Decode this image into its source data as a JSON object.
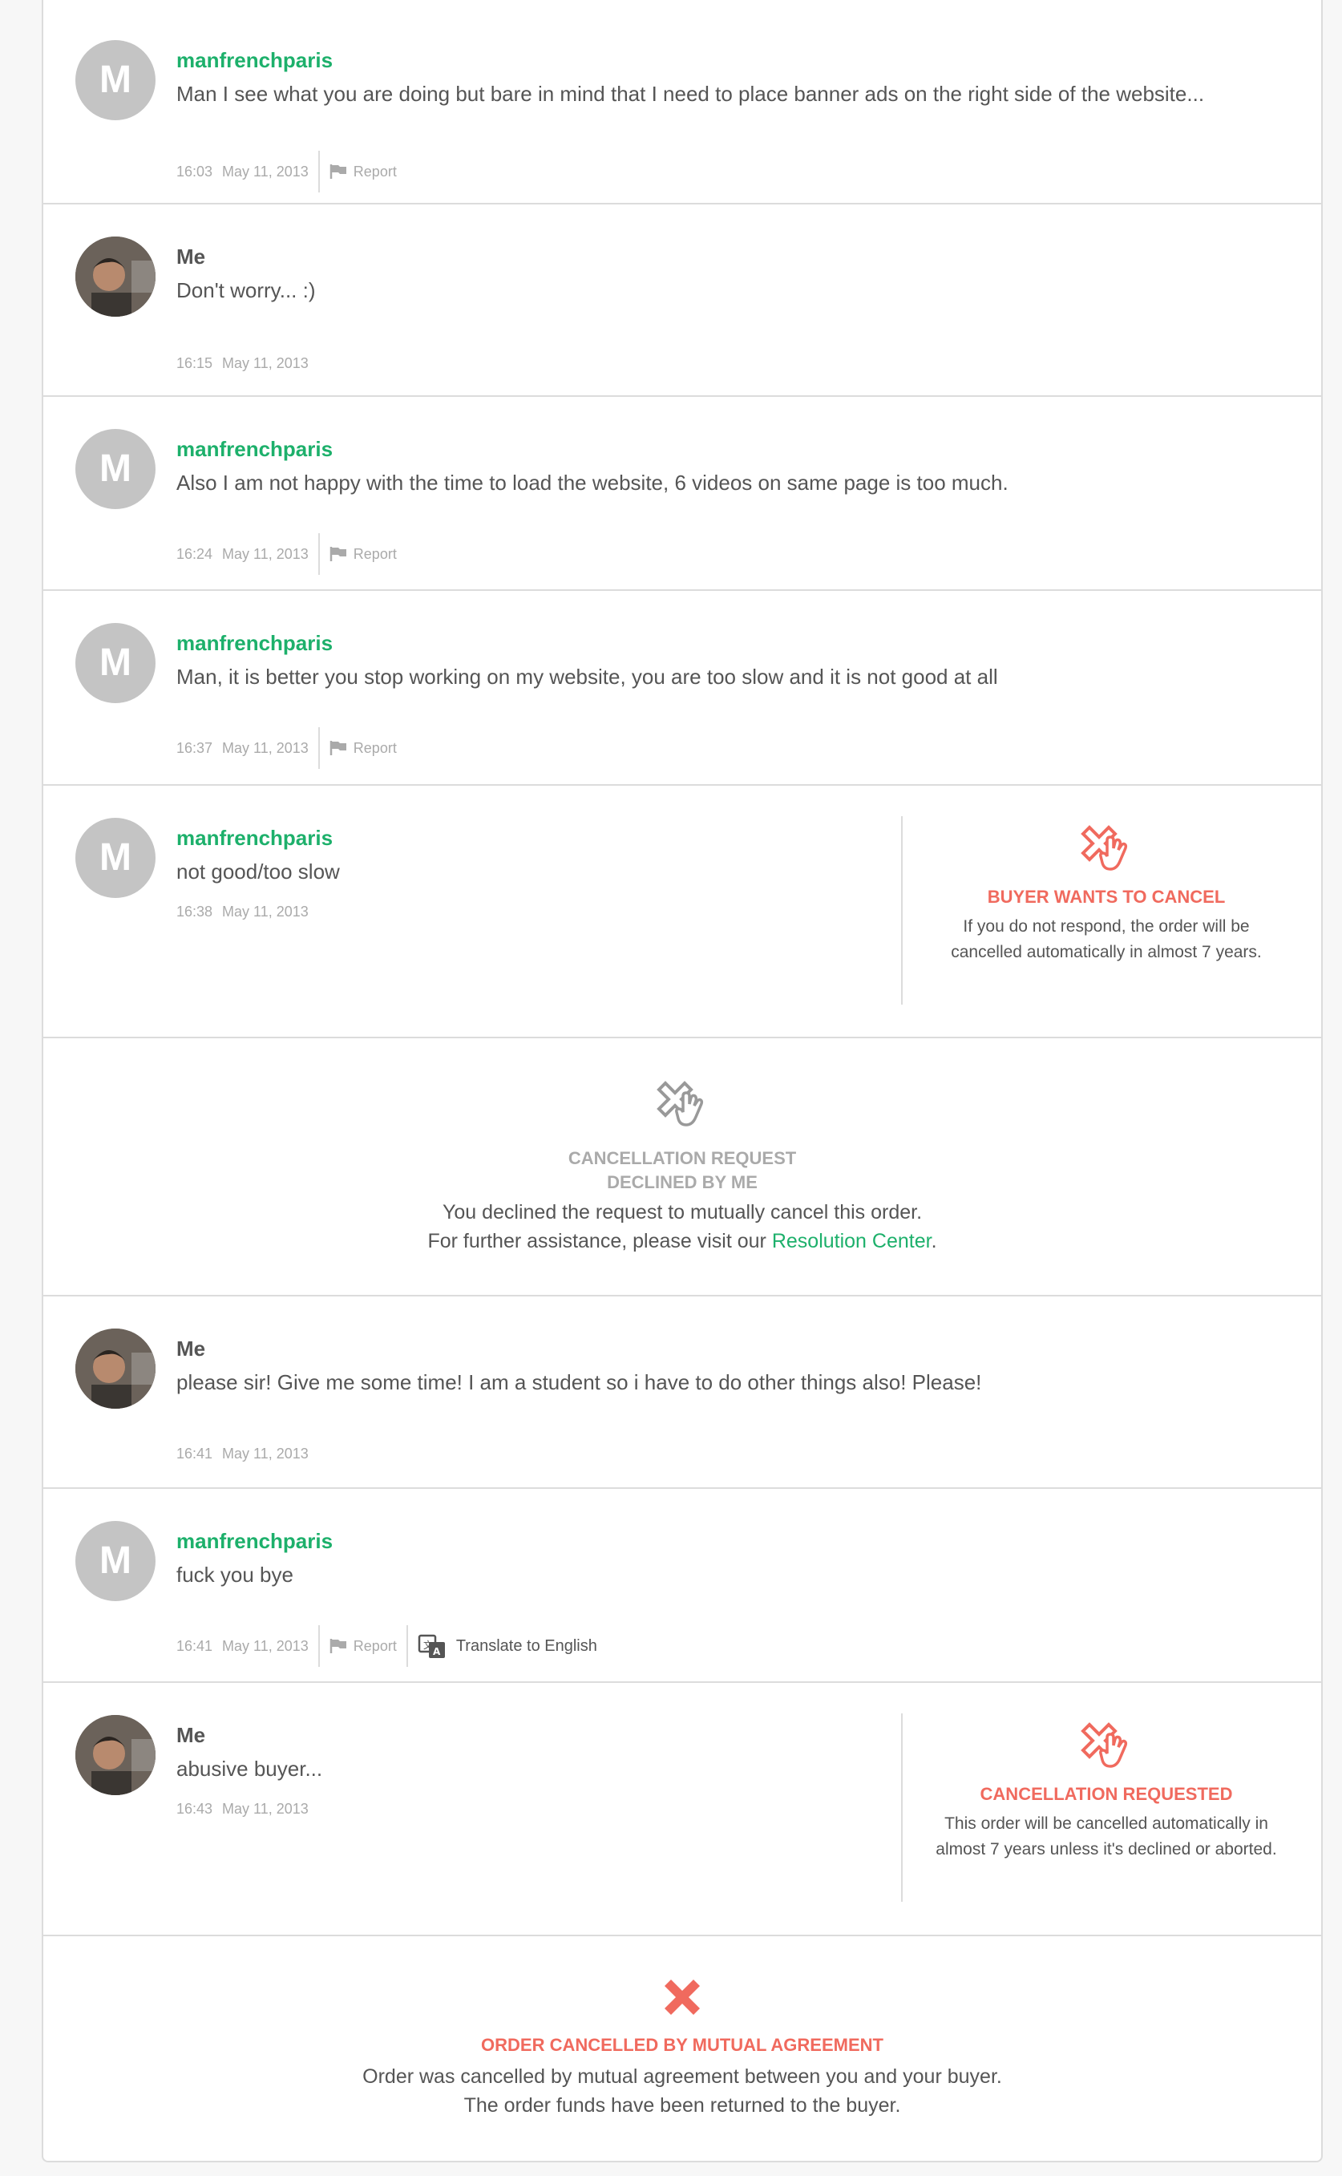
{
  "messages": [
    {
      "user": "manfrenchparis",
      "text": "Man I see what you are doing but bare in mind that I need to place banner ads on the right side of the website...",
      "time": "16:03",
      "date": "May 11, 2013",
      "report": "Report"
    },
    {
      "user": "Me",
      "text": "Don't worry... :)",
      "time": "16:15",
      "date": "May 11, 2013"
    },
    {
      "user": "manfrenchparis",
      "text": "Also I am not happy with the time to load the website, 6 videos on same page is too much.",
      "time": "16:24",
      "date": "May 11, 2013",
      "report": "Report"
    },
    {
      "user": "manfrenchparis",
      "text": "Man, it is better you stop working on my website, you are too slow and it is not good at all",
      "time": "16:37",
      "date": "May 11, 2013",
      "report": "Report"
    },
    {
      "user": "manfrenchparis",
      "text": "not good/too slow",
      "time": "16:38",
      "date": "May 11, 2013"
    },
    {
      "user": "Me",
      "text": "please sir! Give me some time! I am a student so i have to do other things also! Please!",
      "time": "16:41",
      "date": "May 11, 2013"
    },
    {
      "user": "manfrenchparis",
      "text": "fuck you bye",
      "time": "16:41",
      "date": "May 11, 2013",
      "report": "Report",
      "translate": "Translate to English"
    },
    {
      "user": "Me",
      "text": "abusive buyer...",
      "time": "16:43",
      "date": "May 11, 2013"
    }
  ],
  "avatar_letter": "M",
  "buyer_cancel": {
    "title": "BUYER WANTS TO CANCEL",
    "text": "If you do not respond, the order will be cancelled automatically in almost 7 years."
  },
  "declined": {
    "title_line1": "CANCELLATION REQUEST",
    "title_line2": "DECLINED BY ME",
    "text_line1": "You declined the request to mutually cancel this order.",
    "text_line2_prefix": "For further assistance, please visit our",
    "link": "Resolution Center",
    "text_line2_suffix": "."
  },
  "cancel_requested": {
    "title": "CANCELLATION REQUESTED",
    "text": "This order will be cancelled automatically in almost 7 years unless it's declined or aborted."
  },
  "order_cancelled": {
    "title": "ORDER CANCELLED BY MUTUAL AGREEMENT",
    "text_line1": "Order was cancelled by mutual agreement between you and your buyer.",
    "text_line2": "The order funds have been returned to the buyer."
  },
  "colors": {
    "green": "#1db06b",
    "red": "#f06a5e",
    "grey_text": "#aaa",
    "border": "#dcdcdc"
  }
}
